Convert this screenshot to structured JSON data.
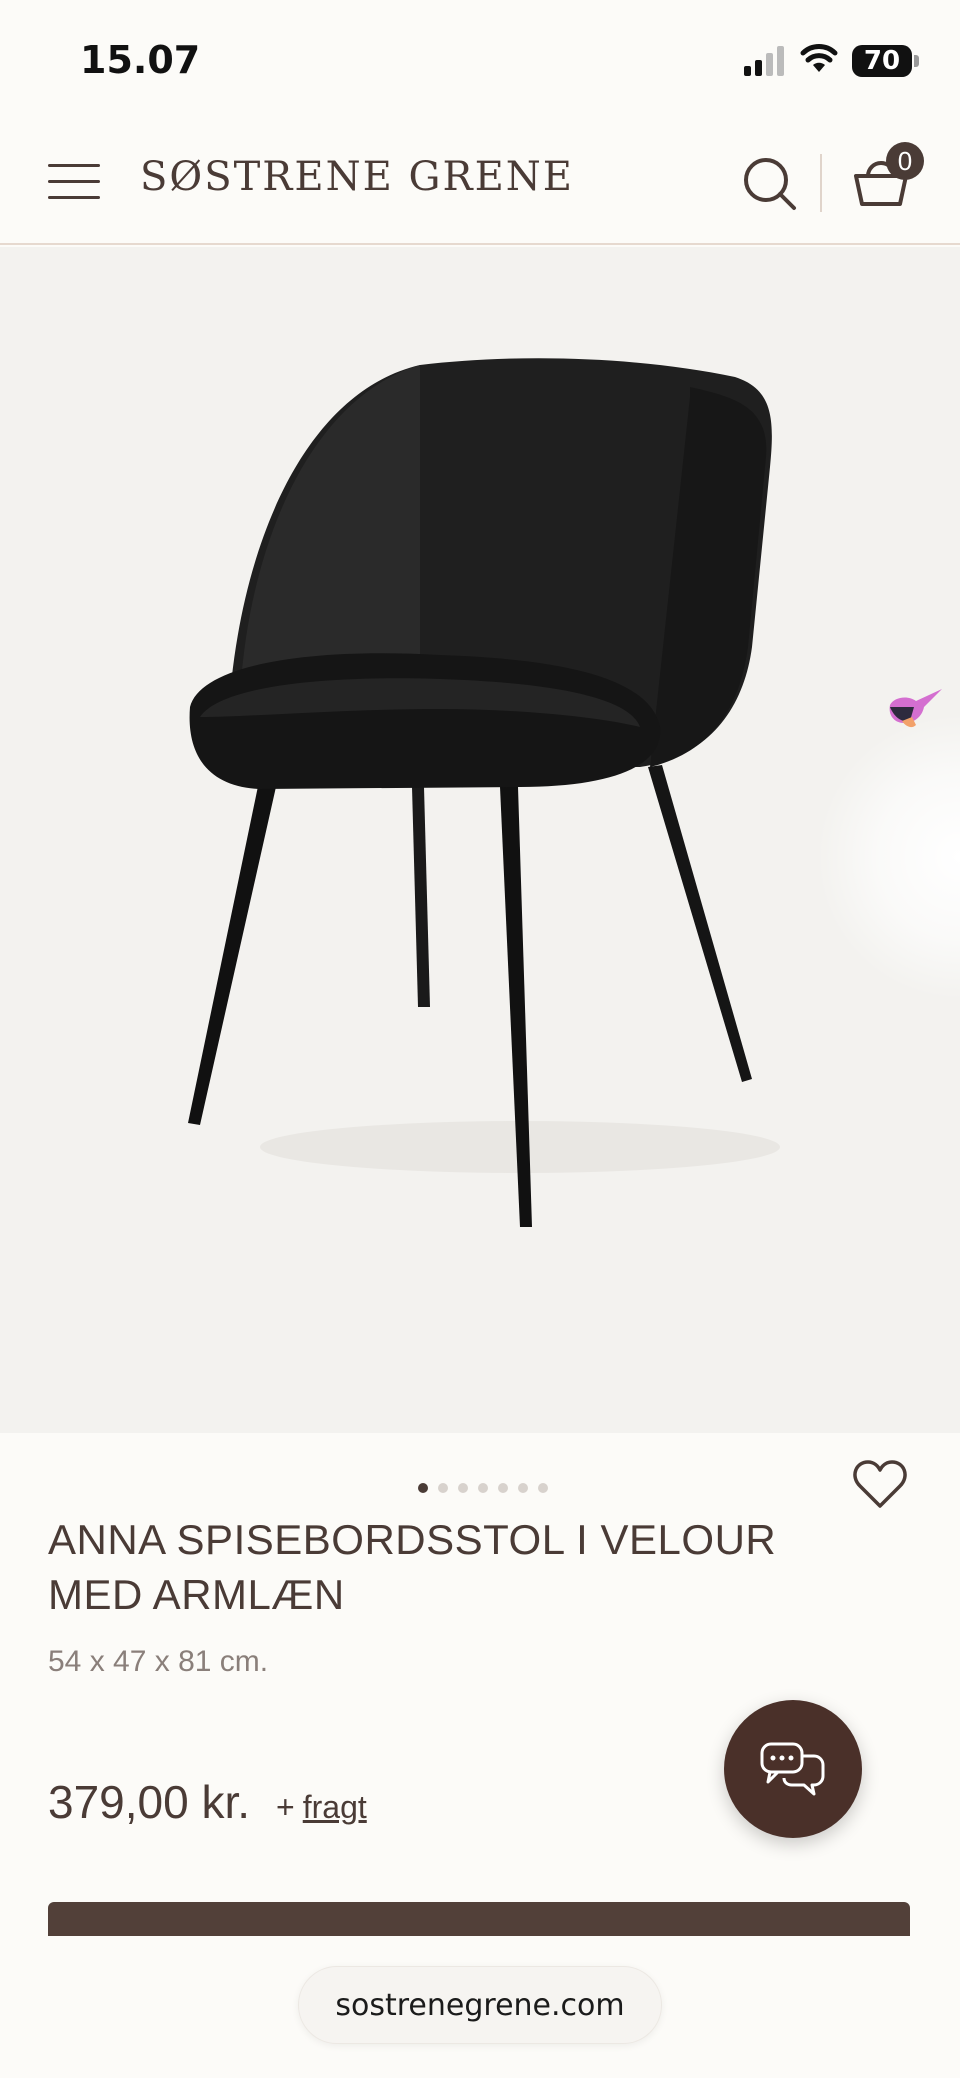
{
  "status_bar": {
    "time": "15.07",
    "battery": "70"
  },
  "header": {
    "logo": "SØSTRENE GRENE",
    "basket_count": "0"
  },
  "product": {
    "image_alt": "Black velour dining chair with armrests",
    "pager": {
      "total": 7,
      "active": 0
    },
    "title_line1": "ANNA SPISEBORDSSTOL I VELOUR",
    "title_line2": "MED ARMLÆN",
    "size": "54 x 47 x 81 cm.",
    "price": "379,00 kr.",
    "plus": "+",
    "freight_link": "fragt"
  },
  "colors": {
    "brand_brown": "#4a3b36",
    "cta": "#524039",
    "background": "#fcfbf8"
  },
  "browser": {
    "url": "sostrenegrene.com"
  }
}
